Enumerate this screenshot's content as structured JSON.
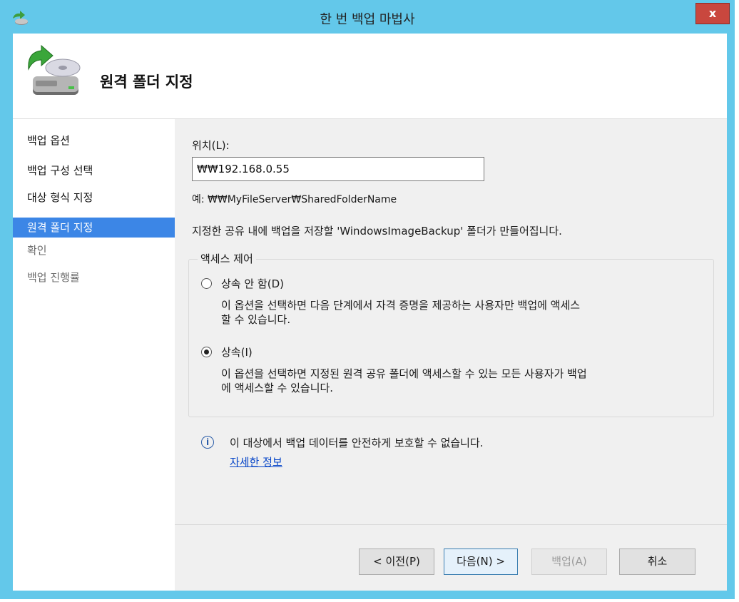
{
  "window": {
    "title": "한 번 백업 마법사",
    "close_label": "x"
  },
  "header": {
    "title": "원격 폴더 지정"
  },
  "sidebar": {
    "items": [
      {
        "label": "백업 옵션"
      },
      {
        "label": "백업 구성 선택"
      },
      {
        "label": "대상 형식 지정"
      },
      {
        "label": "원격 폴더 지정"
      },
      {
        "label": "확인"
      },
      {
        "label": "백업 진행률"
      }
    ]
  },
  "main": {
    "location_label": "위치(L):",
    "location_value": "₩₩192.168.0.55",
    "example_text": "예: ₩₩MyFileServer₩SharedFolderName",
    "info_text": "지정한 공유 내에 백업을 저장할 'WindowsImageBackup' 폴더가 만들어집니다.",
    "access_group": {
      "legend": "액세스 제어",
      "options": [
        {
          "label": "상속 안 함(D)",
          "selected": false,
          "description": "이 옵션을 선택하면 다음 단계에서 자격 증명을 제공하는 사용자만 백업에 액세스\n할 수 있습니다."
        },
        {
          "label": "상속(I)",
          "selected": true,
          "description": "이 옵션을 선택하면 지정된 원격 공유 폴더에 액세스할 수 있는 모든 사용자가 백업\n에 액세스할 수 있습니다."
        }
      ]
    },
    "warning_text": "이 대상에서 백업 데이터를 안전하게 보호할 수 없습니다.",
    "more_info_link": "자세한 정보"
  },
  "buttons": {
    "prev": "< 이전(P)",
    "next": "다음(N) >",
    "backup": "백업(A)",
    "cancel": "취소"
  }
}
